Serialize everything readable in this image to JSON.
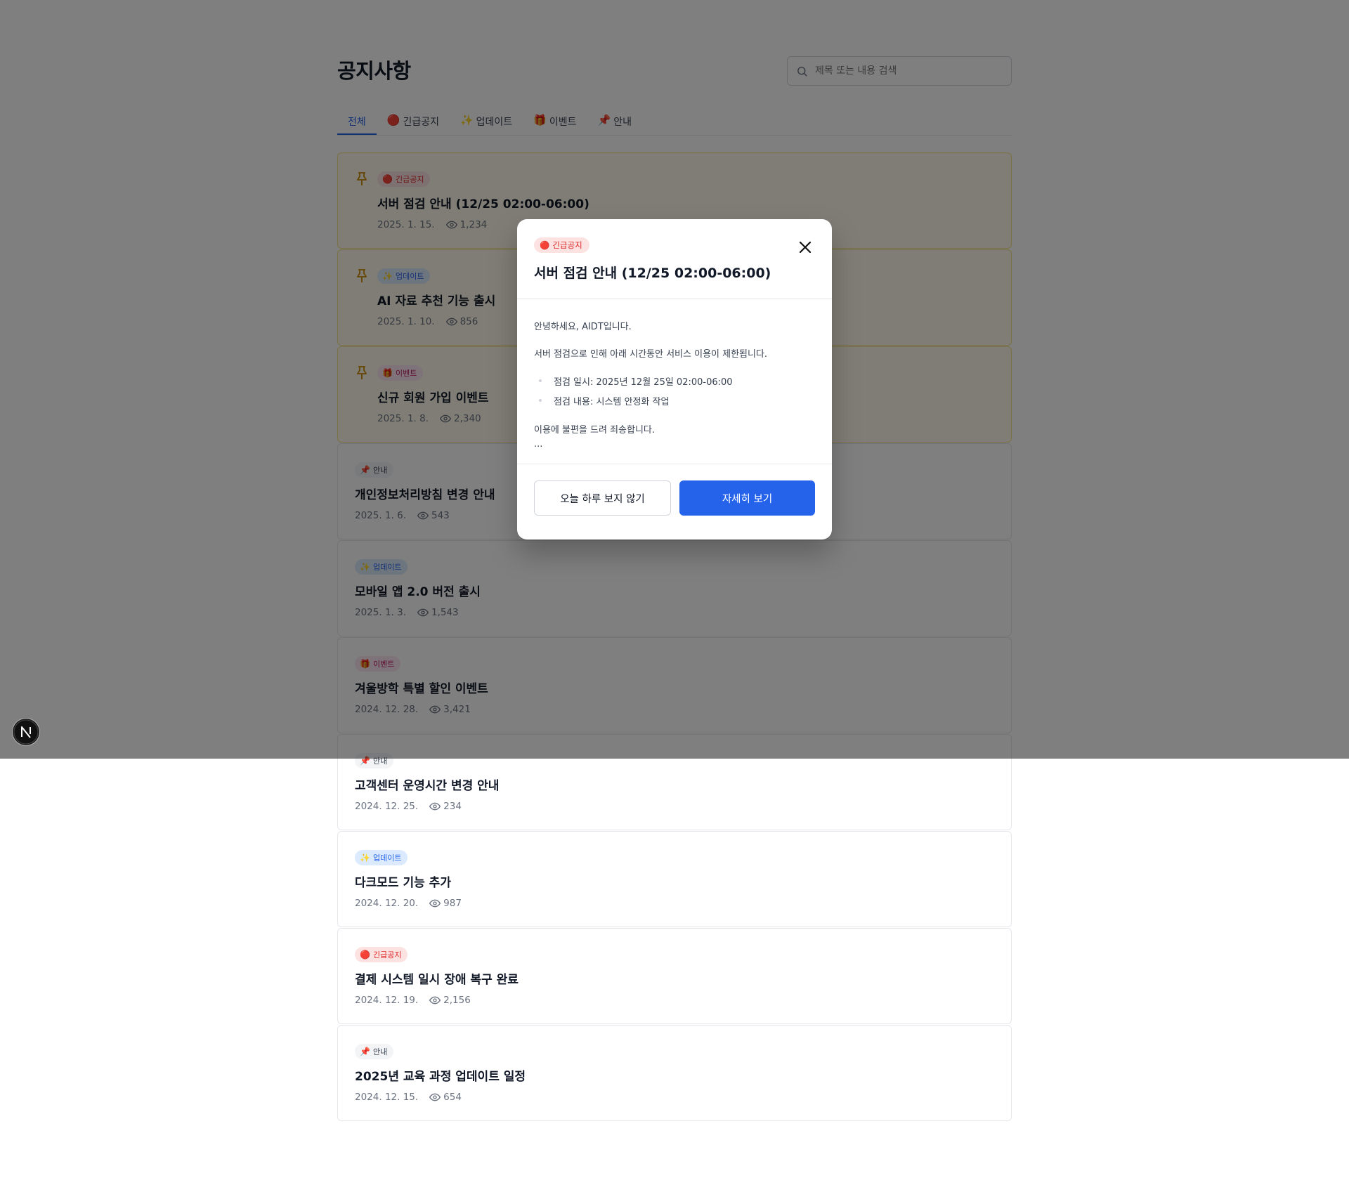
{
  "page": {
    "title": "공지사항",
    "search_placeholder": "제목 또는 내용 검색"
  },
  "tabs": [
    {
      "label": "전체",
      "emoji": "",
      "active": true
    },
    {
      "label": "긴급공지",
      "emoji": "🔴",
      "active": false
    },
    {
      "label": "업데이트",
      "emoji": "✨",
      "active": false
    },
    {
      "label": "이벤트",
      "emoji": "🎁",
      "active": false
    },
    {
      "label": "안내",
      "emoji": "📌",
      "active": false
    }
  ],
  "notices": [
    {
      "badge": "긴급공지",
      "badge_emoji": "🔴",
      "type": "urgent",
      "pinned": true,
      "title": "서버 점검 안내 (12/25 02:00-06:00)",
      "date": "2025. 1. 15.",
      "views": "1,234"
    },
    {
      "badge": "업데이트",
      "badge_emoji": "✨",
      "type": "update",
      "pinned": true,
      "title": "AI 자료 추천 기능 출시",
      "date": "2025. 1. 10.",
      "views": "856"
    },
    {
      "badge": "이벤트",
      "badge_emoji": "🎁",
      "type": "event",
      "pinned": true,
      "title": "신규 회원 가입 이벤트",
      "date": "2025. 1. 8.",
      "views": "2,340"
    },
    {
      "badge": "안내",
      "badge_emoji": "📌",
      "type": "info",
      "pinned": false,
      "title": "개인정보처리방침 변경 안내",
      "date": "2025. 1. 6.",
      "views": "543"
    },
    {
      "badge": "업데이트",
      "badge_emoji": "✨",
      "type": "update",
      "pinned": false,
      "title": "모바일 앱 2.0 버전 출시",
      "date": "2025. 1. 3.",
      "views": "1,543"
    },
    {
      "badge": "이벤트",
      "badge_emoji": "🎁",
      "type": "event",
      "pinned": false,
      "title": "겨울방학 특별 할인 이벤트",
      "date": "2024. 12. 28.",
      "views": "3,421"
    },
    {
      "badge": "안내",
      "badge_emoji": "📌",
      "type": "info",
      "pinned": false,
      "title": "고객센터 운영시간 변경 안내",
      "date": "2024. 12. 25.",
      "views": "234"
    },
    {
      "badge": "업데이트",
      "badge_emoji": "✨",
      "type": "update",
      "pinned": false,
      "title": "다크모드 기능 추가",
      "date": "2024. 12. 20.",
      "views": "987"
    },
    {
      "badge": "긴급공지",
      "badge_emoji": "🔴",
      "type": "urgent",
      "pinned": false,
      "title": "결제 시스템 일시 장애 복구 완료",
      "date": "2024. 12. 19.",
      "views": "2,156"
    },
    {
      "badge": "안내",
      "badge_emoji": "📌",
      "type": "info",
      "pinned": false,
      "title": "2025년 교육 과정 업데이트 일정",
      "date": "2024. 12. 15.",
      "views": "654"
    }
  ],
  "modal": {
    "badge": "긴급공지",
    "badge_emoji": "🔴",
    "title": "서버 점검 안내 (12/25 02:00-06:00)",
    "greeting": "안녕하세요, AIDT입니다.",
    "intro": "서버 점검으로 인해 아래 시간동안 서비스 이용이 제한됩니다.",
    "bullets": [
      "점검 일시: 2025년 12월 25일 02:00-06:00",
      "점검 내용: 시스템 안정화 작업"
    ],
    "apology": "이용에 불편을 드려 죄송합니다.",
    "ellipsis": "...",
    "dismiss_label": "오늘 하루 보지 않기",
    "detail_label": "자세히 보기"
  },
  "dev_badge": {
    "letter": "N"
  }
}
